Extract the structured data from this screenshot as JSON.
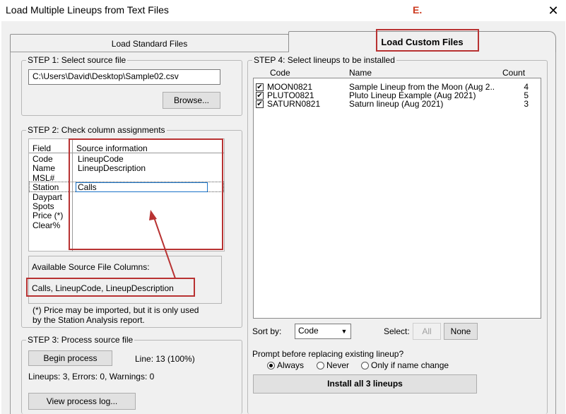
{
  "window": {
    "title": "Load Multiple Lineups from Text Files",
    "close_glyph": "✕"
  },
  "annotation": {
    "marker": "E."
  },
  "tabs": {
    "standard": "Load Standard Files",
    "custom": "Load Custom Files"
  },
  "step1": {
    "legend": "STEP 1: Select source file",
    "path": "C:\\Users\\David\\Desktop\\Sample02.csv",
    "browse": "Browse..."
  },
  "step2": {
    "legend": "STEP 2: Check column assignments",
    "col_field": "Field",
    "col_source": "Source information",
    "rows": [
      {
        "field": "Code",
        "source": "LineupCode"
      },
      {
        "field": "Name",
        "source": "LineupDescription"
      },
      {
        "field": "MSL#",
        "source": ""
      },
      {
        "field": "Station",
        "source": "Calls"
      },
      {
        "field": "Daypart",
        "source": ""
      },
      {
        "field": "Spots",
        "source": ""
      },
      {
        "field": "Price (*)",
        "source": ""
      },
      {
        "field": "Clear%",
        "source": ""
      }
    ],
    "available_label": "Available Source File Columns:",
    "available_columns": "Calls, LineupCode, LineupDescription",
    "price_note": "(*) Price may be imported, but it is only used\nby the Station Analysis report."
  },
  "step3": {
    "legend": "STEP 3: Process source file",
    "begin": "Begin process",
    "line_status": "Line: 13 (100%)",
    "summary": "Lineups: 3, Errors: 0, Warnings: 0",
    "view_log": "View process log..."
  },
  "step4": {
    "legend": "STEP 4: Select lineups to be installed",
    "headers": {
      "code": "Code",
      "name": "Name",
      "count": "Count"
    },
    "lineups": [
      {
        "checked": true,
        "code": "MOON0821",
        "name": "Sample Lineup from the Moon (Aug 2..",
        "count": "4"
      },
      {
        "checked": true,
        "code": "PLUTO0821",
        "name": "Pluto Lineup Example (Aug 2021)",
        "count": "5"
      },
      {
        "checked": true,
        "code": "SATURN0821",
        "name": "Saturn lineup (Aug 2021)",
        "count": "3"
      }
    ],
    "sort_label": "Sort by:",
    "sort_value": "Code",
    "select_label": "Select:",
    "select_all": "All",
    "select_none": "None",
    "prompt_label": "Prompt before replacing existing lineup?",
    "prompt_options": [
      "Always",
      "Never",
      "Only if name change"
    ],
    "prompt_selected": "Always",
    "install": "Install all 3 lineups"
  },
  "colors": {
    "annotation_red": "#b83232",
    "marker_red": "#cc3a1f",
    "check": "✔"
  }
}
